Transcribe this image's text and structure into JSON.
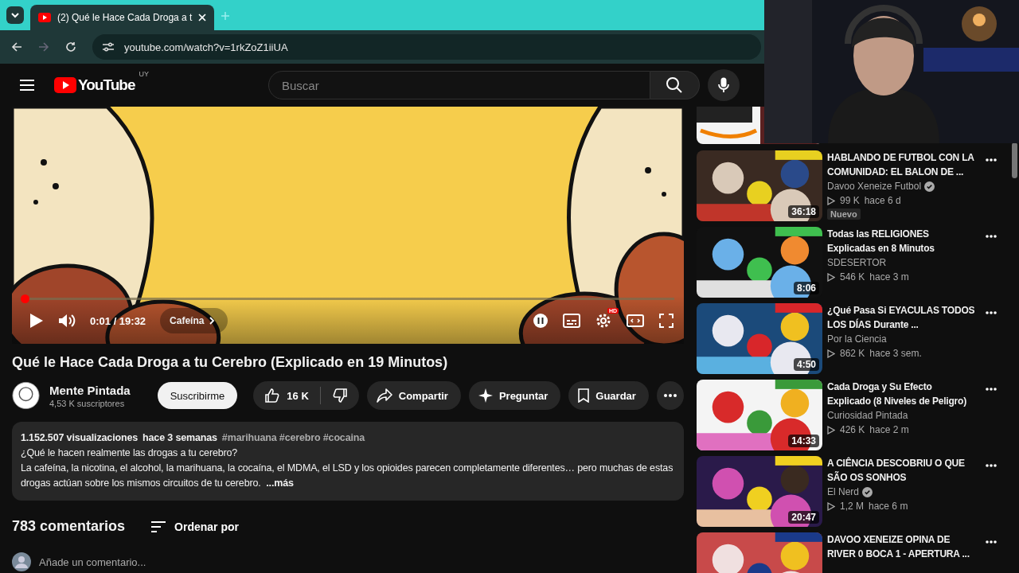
{
  "browser": {
    "tab": {
      "title": "(2) Qué le Hace Cada Droga a t",
      "selected": true
    },
    "url": "youtube.com/watch?v=1rkZoZ1iiUA"
  },
  "header": {
    "logo": "YouTube",
    "country": "UY",
    "search": {
      "placeholder": "Buscar"
    }
  },
  "player": {
    "level": 0.001,
    "time": "0:01 / 19:32",
    "chapter": "Cafeína",
    "quality_badge": "HD"
  },
  "video": {
    "title": "Qué le Hace Cada Droga a tu Cerebro (Explicado en 19 Minutos)",
    "channel": "Mente Pintada",
    "subscribers": "4,53 K suscriptores",
    "subscribe": "Suscribirme",
    "likes": "16 K",
    "actions": [
      {
        "kind": "share",
        "label": "Compartir"
      },
      {
        "kind": "ask",
        "label": "Preguntar"
      },
      {
        "kind": "save",
        "label": "Guardar"
      }
    ]
  },
  "description": {
    "views": "1.152.507 visualizaciones",
    "date": "hace 3 semanas",
    "hashtags": "#marihuana #cerebro #cocaina",
    "headline": "¿Qué le hacen realmente las drogas a tu cerebro?",
    "body": "La cafeína, la nicotina, el alcohol, la marihuana, la cocaína, el MDMA, el LSD y los opioides parecen completamente diferentes… pero muchas de estas drogas actúan sobre los mismos circuitos de tu cerebro.",
    "more": "...más"
  },
  "comments": {
    "count": "783 comentarios",
    "sort": "Ordenar por",
    "placeholder": "Añade un comentario..."
  },
  "sidebar": {
    "items": [
      {
        "title": "HABLANDO DE FUTBOL CON LA COMUNIDAD: EL BALON DE ...",
        "channel": "Davoo Xeneize Futbol",
        "verified": true,
        "views": "99 K",
        "age": "hace 6 d",
        "duration": "36:18",
        "badge": "Nuevo"
      },
      {
        "title": "Todas las RELIGIONES Explicadas en 8 Minutos",
        "channel": "SDESERTOR",
        "verified": false,
        "views": "546 K",
        "age": "hace 3 m",
        "duration": "8:06"
      },
      {
        "title": "¿Qué Pasa Si EYACULAS TODOS LOS DÍAS Durante ...",
        "channel": "Por la Ciencia",
        "verified": false,
        "views": "862 K",
        "age": "hace 3 sem.",
        "duration": "4:50"
      },
      {
        "title": "Cada Droga y Su Efecto Explicado (8 Niveles de Peligro)",
        "channel": "Curiosidad Pintada",
        "verified": false,
        "views": "426 K",
        "age": "hace 2 m",
        "duration": "14:33"
      },
      {
        "title": "A CIÊNCIA DESCOBRIU O QUE SÃO OS SONHOS",
        "channel": "El Nerd",
        "verified": true,
        "views": "1,2 M",
        "age": "hace 6 m",
        "duration": "20:47"
      },
      {
        "title": "DAVOO XENEIZE OPINA DE RIVER 0 BOCA 1 - APERTURA ..."
      }
    ]
  }
}
